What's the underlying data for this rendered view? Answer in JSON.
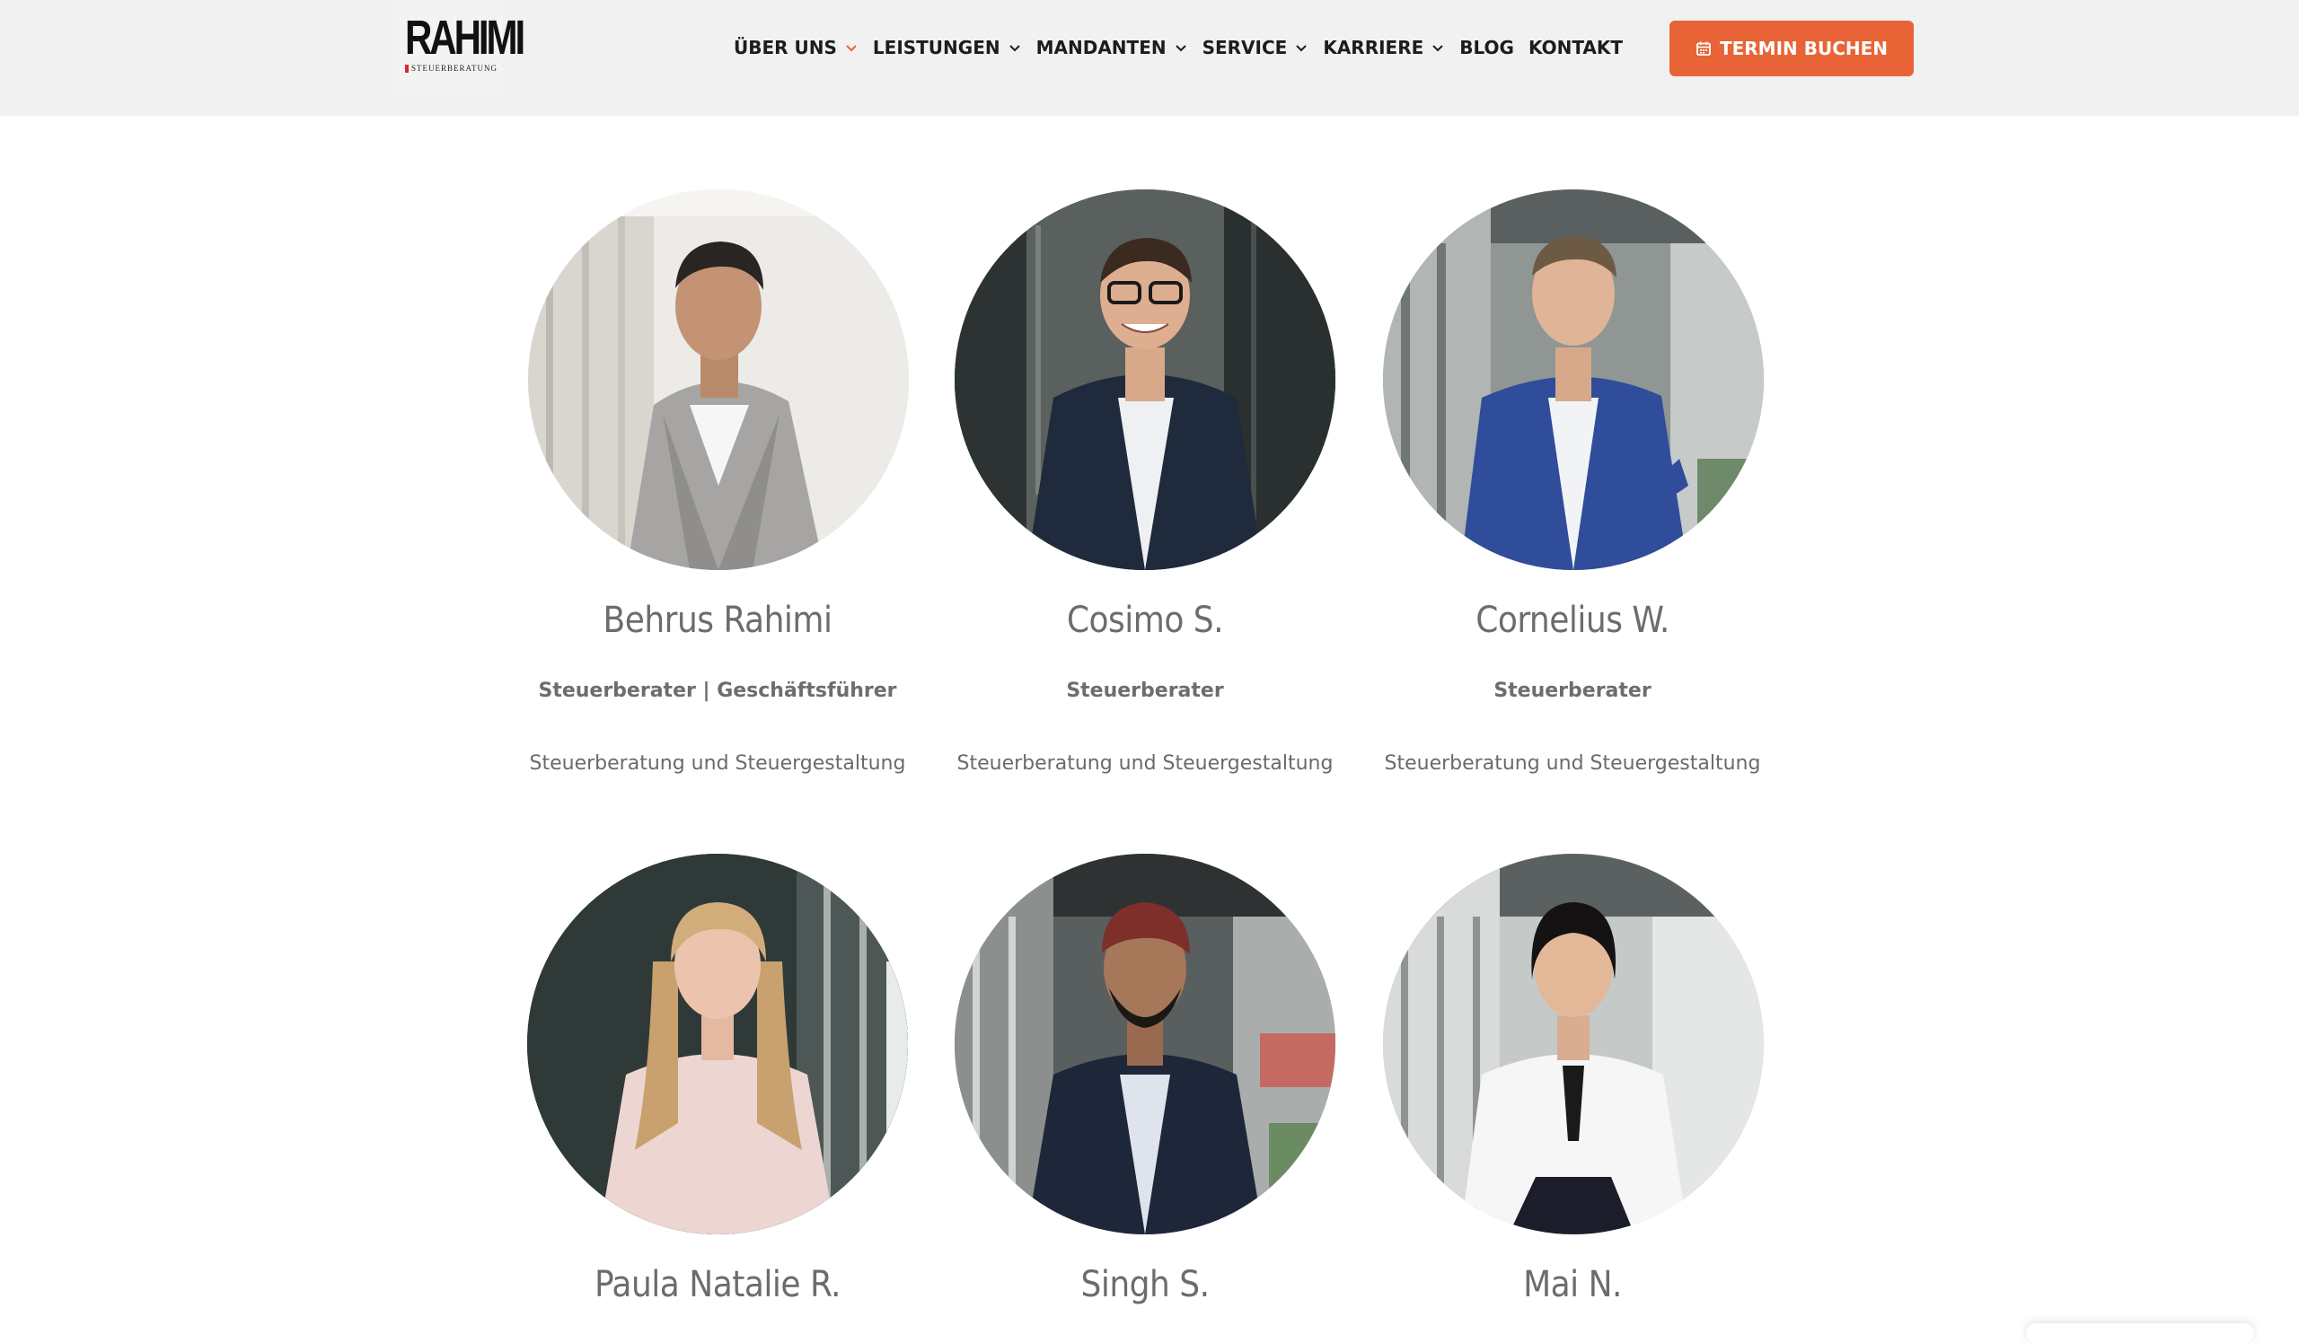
{
  "header": {
    "logo": {
      "word": "RAHIMI",
      "sub": "STEUERBERATUNG"
    },
    "nav": [
      {
        "label": "ÜBER UNS",
        "has_dropdown": true,
        "chevron_color": "#e86436"
      },
      {
        "label": "LEISTUNGEN",
        "has_dropdown": true,
        "chevron_color": "#1c1c1c"
      },
      {
        "label": "MANDANTEN",
        "has_dropdown": true,
        "chevron_color": "#1c1c1c"
      },
      {
        "label": "SERVICE",
        "has_dropdown": true,
        "chevron_color": "#1c1c1c"
      },
      {
        "label": "KARRIERE",
        "has_dropdown": true,
        "chevron_color": "#1c1c1c"
      },
      {
        "label": "BLOG",
        "has_dropdown": false
      },
      {
        "label": "KONTAKT",
        "has_dropdown": false
      }
    ],
    "cta": {
      "label": "TERMIN BUCHEN",
      "icon": "calendar-icon",
      "color": "#e86436"
    }
  },
  "team": [
    {
      "name": "Behrus Rahimi",
      "role": "Steuerberater | Geschäftsführer",
      "desc": "Steuerberatung und Steuergestaltung",
      "photo": "portrait-grey-suit"
    },
    {
      "name": "Cosimo S.",
      "role": "Steuerberater",
      "desc": "Steuerberatung und Steuergestaltung",
      "photo": "portrait-navy-suit-glasses"
    },
    {
      "name": "Cornelius W.",
      "role": "Steuerberater",
      "desc": "Steuerberatung und Steuergestaltung",
      "photo": "portrait-blue-suit"
    },
    {
      "name": "Paula Natalie R.",
      "role": "",
      "desc": "",
      "photo": "portrait-pink-blouse"
    },
    {
      "name": "Singh S.",
      "role": "",
      "desc": "",
      "photo": "portrait-turban-navy-jacket"
    },
    {
      "name": "Mai N.",
      "role": "",
      "desc": "",
      "photo": "portrait-white-blouse"
    }
  ],
  "colors": {
    "accent": "#e86436",
    "header_bg": "#f1f1f1",
    "text_grey": "#6c6c6c"
  }
}
